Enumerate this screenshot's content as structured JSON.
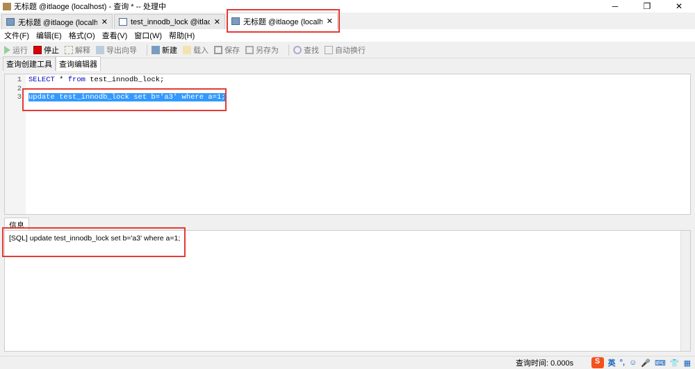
{
  "window": {
    "title": "无标题 @itlaoge (localhost) - 查询 * -- 处理中",
    "minimize": "─",
    "restore": "❐",
    "close": "✕"
  },
  "tabs": [
    {
      "label": "无标题 @itlaoge (localh..."
    },
    {
      "label": "test_innodb_lock @itlaog..."
    },
    {
      "label": "无标题 @itlaoge (localh..."
    }
  ],
  "tab_close": "✕",
  "menu": [
    "文件(F)",
    "编辑(E)",
    "格式(O)",
    "查看(V)",
    "窗口(W)",
    "帮助(H)"
  ],
  "toolbar": {
    "run": "运行",
    "stop": "停止",
    "explain": "解释",
    "export": "导出向导",
    "new": "新建",
    "load": "载入",
    "save": "保存",
    "save_as": "另存为",
    "find": "查找",
    "wrap": "自动换行"
  },
  "subtabs": [
    "查询创建工具",
    "查询编辑器"
  ],
  "editor": {
    "line_numbers": [
      "1",
      "2",
      "3"
    ],
    "line1_kw1": "SELECT",
    "line1_rest1": " * ",
    "line1_kw2": "from",
    "line1_rest2": " test_innodb_lock;",
    "line3": "update test_innodb_lock set b='a3' where a=1;"
  },
  "info": {
    "tab": "信息",
    "message": "[SQL] update test_innodb_lock set b='a3' where a=1;"
  },
  "status": {
    "query_time": "查询时间: 0.000s"
  },
  "ime": {
    "logo": "S",
    "lang": "英",
    "punct": "°,",
    "emoji": "☺",
    "mic": "🎤",
    "keyboard": "⌨",
    "skin": "👕",
    "grid": "▦"
  }
}
